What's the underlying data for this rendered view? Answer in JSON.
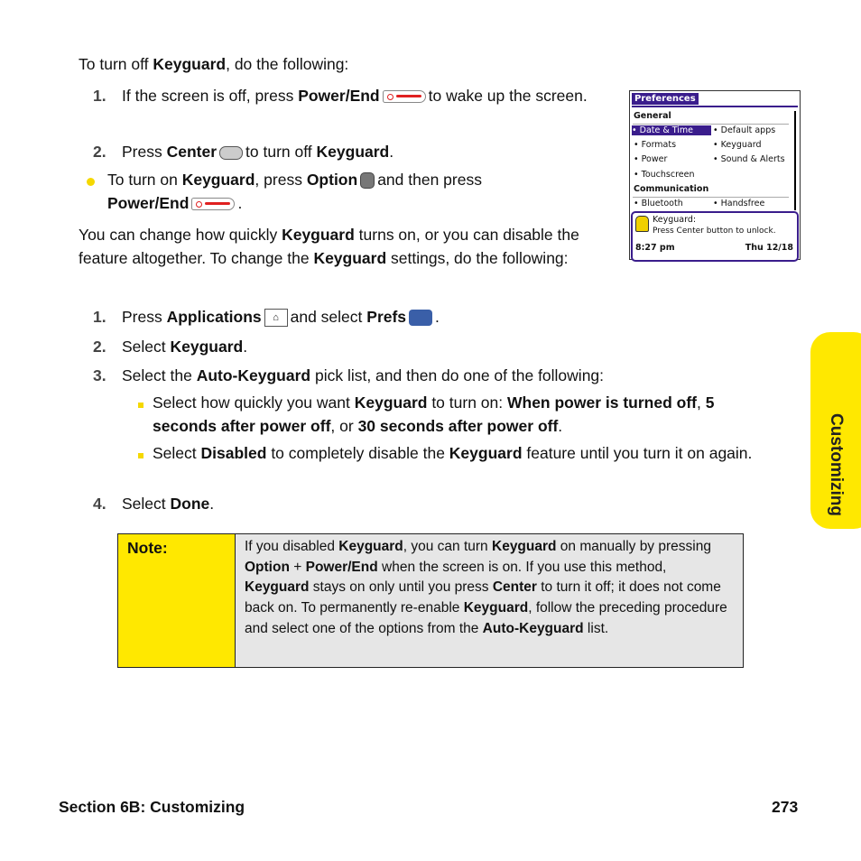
{
  "intro": [
    [
      "To turn off ",
      0
    ],
    [
      "Keyguard",
      1
    ],
    [
      ", do the following:",
      0
    ]
  ],
  "steps1": [
    {
      "num": "1.",
      "segs": [
        [
          "If the screen is off, press ",
          0
        ],
        [
          "Power/End",
          1
        ],
        {
          "icon": "power-end"
        },
        [
          "to wake up the screen.",
          0
        ]
      ]
    },
    {
      "num": "2.",
      "segs": [
        [
          "Press ",
          0
        ],
        [
          "Center",
          1
        ],
        {
          "icon": "center"
        },
        [
          "to turn off ",
          0
        ],
        [
          "Keyguard",
          1
        ],
        [
          ".",
          0
        ]
      ]
    }
  ],
  "tip": [
    [
      "To turn on ",
      0
    ],
    [
      "Keyguard",
      1
    ],
    [
      ", press ",
      0
    ],
    [
      "Option",
      1
    ],
    {
      "icon": "option"
    },
    [
      "and then press ",
      0
    ],
    [
      "Power/End",
      1
    ],
    {
      "icon": "power-end"
    },
    [
      ".",
      0
    ]
  ],
  "para": [
    [
      "You can change how quickly ",
      0
    ],
    [
      "Keyguard",
      1
    ],
    [
      " turns on, or you can disable the feature altogether. To change the ",
      0
    ],
    [
      "Keyguard",
      1
    ],
    [
      " settings, do the following:",
      0
    ]
  ],
  "steps2": [
    {
      "num": "1.",
      "segs": [
        [
          "Press ",
          0
        ],
        [
          "Applications",
          1
        ],
        {
          "icon": "applications"
        },
        [
          "and select ",
          0
        ],
        [
          "Prefs",
          1
        ],
        {
          "icon": "prefs"
        },
        [
          ".",
          0
        ]
      ]
    },
    {
      "num": "2.",
      "segs": [
        [
          "Select ",
          0
        ],
        [
          "Keyguard",
          1
        ],
        [
          ".",
          0
        ]
      ]
    },
    {
      "num": "3.",
      "segs": [
        [
          "Select the ",
          0
        ],
        [
          "Auto-Keyguard",
          1
        ],
        [
          " pick list, and then do one of the following:",
          0
        ]
      ]
    }
  ],
  "subs": [
    [
      [
        "Select how quickly you want ",
        0
      ],
      [
        "Keyguard",
        1
      ],
      [
        " to turn on: ",
        0
      ],
      [
        "When power is turned off",
        1
      ],
      [
        ", ",
        0
      ],
      [
        "5 seconds after power off",
        1
      ],
      [
        ", or ",
        0
      ],
      [
        "30 seconds after power off",
        1
      ],
      [
        ".",
        0
      ]
    ],
    [
      [
        "Select ",
        0
      ],
      [
        "Disabled",
        1
      ],
      [
        " to completely disable the ",
        0
      ],
      [
        "Keyguard",
        1
      ],
      [
        " feature until you turn it on again.",
        0
      ]
    ]
  ],
  "step4": {
    "num": "4.",
    "segs": [
      [
        "Select ",
        0
      ],
      [
        "Done",
        1
      ],
      [
        ".",
        0
      ]
    ]
  },
  "note": {
    "label": "Note:",
    "segs": [
      [
        "If you disabled ",
        0
      ],
      [
        "Keyguard",
        1
      ],
      [
        ", you can turn ",
        0
      ],
      [
        "Keyguard",
        1
      ],
      [
        " on manually by pressing ",
        0
      ],
      [
        "Option",
        1
      ],
      [
        " + ",
        0
      ],
      [
        "Power/End",
        1
      ],
      [
        " when the screen is on. If you use this method, ",
        0
      ],
      [
        "Keyguard",
        1
      ],
      [
        " stays on only until you press ",
        0
      ],
      [
        "Center",
        1
      ],
      [
        " to turn it off; it does not come back on. To permanently re-enable ",
        0
      ],
      [
        "Keyguard",
        1
      ],
      [
        ", follow the preceding procedure and select one of the options from the ",
        0
      ],
      [
        "Auto-Keyguard",
        1
      ],
      [
        " list.",
        0
      ]
    ]
  },
  "device": {
    "title": "Preferences",
    "general": "General",
    "items": [
      "Date & Time",
      "Default apps",
      "Formats",
      "Keyguard",
      "Power",
      "Sound & Alerts",
      "Touchscreen"
    ],
    "communication": "Communication",
    "comm_items": [
      "Bluetooth",
      "Handsfree"
    ],
    "kg_title": "Keyguard:",
    "kg_msg": "Press Center button to unlock.",
    "time": "8:27 pm",
    "date": "Thu 12/18"
  },
  "side_tab": "Customizing",
  "footer": {
    "section": "Section 6B: Customizing",
    "page": "273"
  },
  "colors": {
    "accent": "#ffe800",
    "device_purple": "#3a1d8c"
  }
}
